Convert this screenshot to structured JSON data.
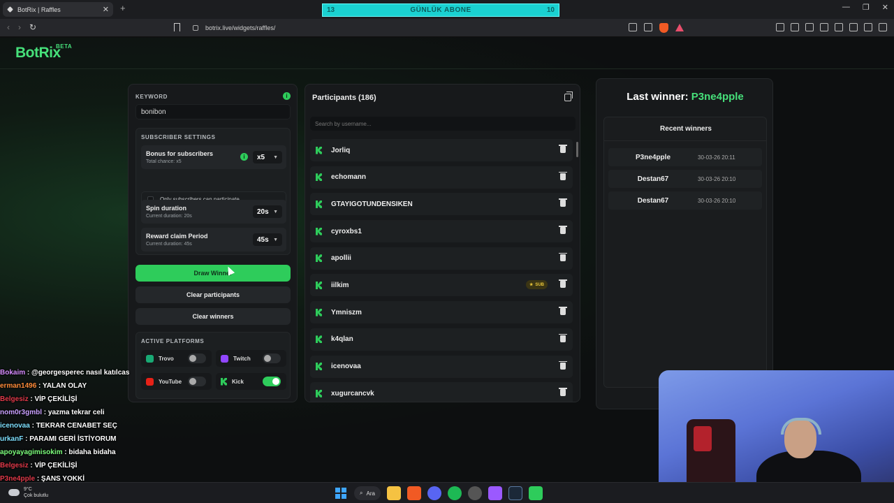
{
  "browser": {
    "tab_title": "BotRix | Raffles",
    "url": "botrix.live/widgets/raffles/"
  },
  "sub_goal": {
    "left": "13",
    "label": "GÜNLÜK ABONE",
    "right": "10"
  },
  "app": {
    "logo": "BotRix",
    "badge": "BETA"
  },
  "keyword": {
    "label": "KEYWORD",
    "value": "bonibon"
  },
  "subscriber_settings": {
    "label": "SUBSCRIBER SETTINGS",
    "bonus": {
      "title": "Bonus for subscribers",
      "subtitle": "Total chance: x5",
      "value": "x5"
    },
    "only_subs": "Only subscribers can participate",
    "spin": {
      "title": "Spin duration",
      "subtitle": "Current duration: 20s",
      "value": "20s"
    },
    "reward": {
      "title": "Reward claim Period",
      "subtitle": "Current duration: 45s",
      "value": "45s"
    }
  },
  "buttons": {
    "draw": "Draw Winner",
    "clear_participants": "Clear participants",
    "clear_winners": "Clear winners"
  },
  "platforms": {
    "label": "ACTIVE PLATFORMS",
    "items": [
      {
        "name": "Trovo",
        "on": false,
        "color": "#19a974"
      },
      {
        "name": "Twitch",
        "on": false,
        "color": "#9146ff"
      },
      {
        "name": "YouTube",
        "on": false,
        "color": "#e62117"
      },
      {
        "name": "Kick",
        "on": true,
        "color": "#2ecc5b"
      }
    ]
  },
  "participants": {
    "title": "Participants (186)",
    "search_placeholder": "Search by username...",
    "list": [
      {
        "name": "Jorliq",
        "sub": false
      },
      {
        "name": "echomann",
        "sub": false
      },
      {
        "name": "GTAYIGOTUNDENSIKEN",
        "sub": false
      },
      {
        "name": "cyroxbs1",
        "sub": false
      },
      {
        "name": "apollii",
        "sub": false
      },
      {
        "name": "iilkim",
        "sub": true
      },
      {
        "name": "Ymniszm",
        "sub": false
      },
      {
        "name": "k4qlan",
        "sub": false
      },
      {
        "name": "icenovaa",
        "sub": false
      },
      {
        "name": "xugurcancvk",
        "sub": false
      }
    ],
    "sub_badge": "SUB"
  },
  "winner": {
    "label": "Last winner:",
    "name": "P3ne4pple",
    "recent_title": "Recent winners",
    "recent": [
      {
        "name": "P3ne4pple",
        "time": "30-03-26 20:11"
      },
      {
        "name": "Destan67",
        "time": "30-03-26 20:10"
      },
      {
        "name": "Destan67",
        "time": "30-03-26 20:10"
      }
    ]
  },
  "chat": [
    {
      "user": "Bokaim",
      "color": "#d68cff",
      "msg": ": @georgesperec nasıl katılcas"
    },
    {
      "user": "erman1496",
      "color": "#ff8c3a",
      "msg": ": YALAN OLAY"
    },
    {
      "user": "Belgesiz",
      "color": "#e23a4a",
      "msg": ": VİP ÇEKİLİŞİ"
    },
    {
      "user": "nom0r3gmbl",
      "color": "#c9a0ff",
      "msg": ": yazma tekrar celi"
    },
    {
      "user": "icenovaa",
      "color": "#7ee0ff",
      "msg": ": TEKRAR CENABET SEÇ"
    },
    {
      "user": "urkanF",
      "color": "#7ee0ff",
      "msg": ": PARAMI GERİ İSTİYORUM"
    },
    {
      "user": "apoyayagimisokim",
      "color": "#7dff7d",
      "msg": ": bidaha bidaha"
    },
    {
      "user": "Belgesiz",
      "color": "#e23a4a",
      "msg": ": VİP ÇEKİLİŞİ"
    },
    {
      "user": "P3ne4pple",
      "color": "#e23a4a",
      "msg": ": ŞANS YOKKİ"
    }
  ],
  "taskbar": {
    "temp": "9°C",
    "weather": "Çok bulutlu",
    "search": "Ara"
  }
}
